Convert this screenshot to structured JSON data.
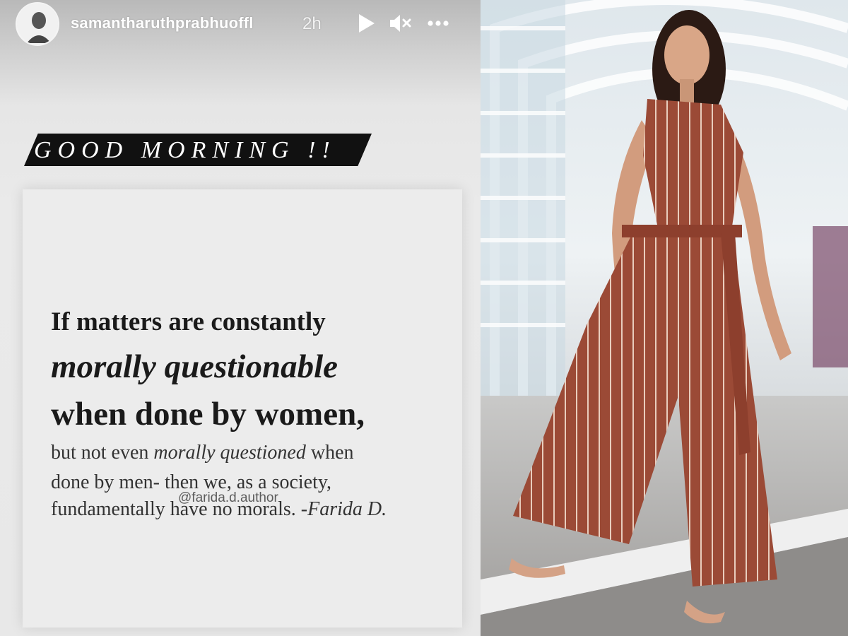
{
  "story": {
    "username": "samantharuthprabhuoffl",
    "timestamp": "2h",
    "icons": {
      "avatar": "profile-avatar",
      "play": "play-icon",
      "mute": "mute-icon",
      "more": "more-options-icon"
    },
    "greeting": "GOOD MORNING !!",
    "quote": {
      "line1": "If matters are constantly",
      "line2": "morally questionable",
      "line3": "when done by women,",
      "line4_before": "but not even ",
      "line4_emphasis": "morally questioned",
      "line4_after": " when",
      "line5": "done by men- then we, as a society,",
      "line6": "fundamentally have no morals. ",
      "attribution": "-Farida D."
    },
    "mention": "@farida.d.author"
  },
  "photo": {
    "description_icon": "woman-in-striped-jumpsuit-image"
  },
  "colors": {
    "banner": "#111111",
    "text": "#1a1a1a",
    "jumpsuit": "#9b4a36"
  }
}
